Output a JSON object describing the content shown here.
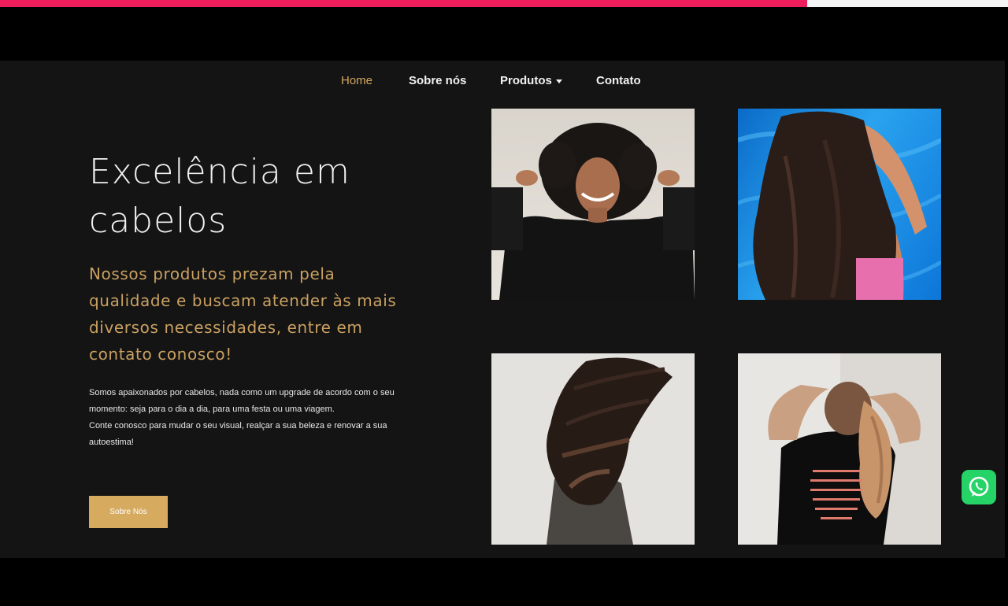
{
  "nav": {
    "items": [
      {
        "label": "Home",
        "active": true
      },
      {
        "label": "Sobre nós",
        "active": false
      },
      {
        "label": "Produtos",
        "active": false,
        "has_dropdown": true
      },
      {
        "label": "Contato",
        "active": false
      }
    ]
  },
  "hero": {
    "title_line1": "Excelência em",
    "title_line2": "cabelos",
    "subtitle": "Nossos produtos prezam pela qualidade e buscam atender às mais diversos necessidades, entre em contato conosco!",
    "body_p1": "Somos apaixonados por cabelos, nada como um upgrade de acordo com o seu momento: seja para o dia a dia, para uma festa ou uma viagem.",
    "body_p2": "Conte conosco para mudar o seu visual, realçar a sua beleza e renovar a sua autoestima!",
    "cta_label": "Sobre Nós"
  },
  "photos": [
    {
      "subject": "woman-curly-hair-smiling"
    },
    {
      "subject": "woman-long-hair-pool"
    },
    {
      "subject": "woman-hair-flip"
    },
    {
      "subject": "woman-wavy-hair-from-back"
    }
  ],
  "colors": {
    "accent": "#d6aa5f",
    "accent_text": "#c9a061",
    "background": "#141414",
    "top_bar": "#ee1d5b",
    "whatsapp": "#25d366"
  },
  "icons": {
    "whatsapp": "whatsapp-icon"
  }
}
